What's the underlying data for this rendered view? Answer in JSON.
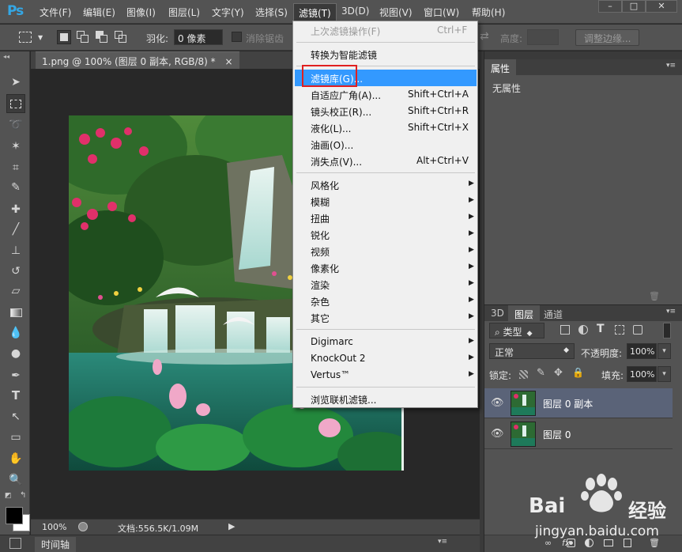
{
  "app": {
    "logo": "Ps"
  },
  "menubar": {
    "items": [
      "文件(F)",
      "编辑(E)",
      "图像(I)",
      "图层(L)",
      "文字(Y)",
      "选择(S)",
      "滤镜(T)",
      "3D(D)",
      "视图(V)",
      "窗口(W)",
      "帮助(H)"
    ],
    "active_index": 6
  },
  "options_bar": {
    "feather_label": "羽化:",
    "feather_value": "0 像素",
    "antialias_label": "消除锯齿",
    "height_label": "高度:",
    "refine_edge_label": "调整边缘..."
  },
  "document": {
    "tab_title": "1.png @ 100% (图层 0 副本, RGB/8) *",
    "close_symbol": "×"
  },
  "status": {
    "zoom": "100%",
    "doc_info": "文档:556.5K/1.09M"
  },
  "timeline": {
    "label": "时间轴"
  },
  "properties_panel": {
    "tab": "属性",
    "content": "无属性"
  },
  "layers_panel": {
    "tabs": [
      "3D",
      "图层",
      "通道"
    ],
    "active_tab": 1,
    "filter_kind": "类型",
    "blend_mode": "正常",
    "opacity_label": "不透明度:",
    "opacity_value": "100%",
    "lock_label": "锁定:",
    "fill_label": "填充:",
    "fill_value": "100%",
    "layers": [
      {
        "name": "图层 0 副本",
        "selected": true,
        "visible": true
      },
      {
        "name": "图层 0",
        "selected": false,
        "visible": true
      }
    ]
  },
  "filter_menu": {
    "items": [
      {
        "label": "上次滤镜操作(F)",
        "shortcut": "Ctrl+F",
        "disabled": true
      },
      {
        "label": "转换为智能滤镜"
      },
      {
        "label": "滤镜库(G)...",
        "highlight": true
      },
      {
        "label": "自适应广角(A)...",
        "shortcut": "Shift+Ctrl+A"
      },
      {
        "label": "镜头校正(R)...",
        "shortcut": "Shift+Ctrl+R"
      },
      {
        "label": "液化(L)...",
        "shortcut": "Shift+Ctrl+X"
      },
      {
        "label": "油画(O)..."
      },
      {
        "label": "消失点(V)...",
        "shortcut": "Alt+Ctrl+V"
      },
      {
        "label": "风格化",
        "submenu": true
      },
      {
        "label": "模糊",
        "submenu": true
      },
      {
        "label": "扭曲",
        "submenu": true
      },
      {
        "label": "锐化",
        "submenu": true
      },
      {
        "label": "视频",
        "submenu": true
      },
      {
        "label": "像素化",
        "submenu": true
      },
      {
        "label": "渲染",
        "submenu": true
      },
      {
        "label": "杂色",
        "submenu": true
      },
      {
        "label": "其它",
        "submenu": true
      },
      {
        "label": "Digimarc",
        "submenu": true
      },
      {
        "label": "KnockOut 2",
        "submenu": true
      },
      {
        "label": "Vertus™",
        "submenu": true
      },
      {
        "label": "浏览联机滤镜..."
      }
    ]
  },
  "watermark": {
    "brand_left": "Bai",
    "brand_right": "经验",
    "url": "jingyan.baidu.com"
  },
  "colors": {
    "ui_dark": "#535353",
    "menu_highlight": "#3399ff",
    "selection_box": "#e02020",
    "layer_selected": "#5a6378"
  }
}
